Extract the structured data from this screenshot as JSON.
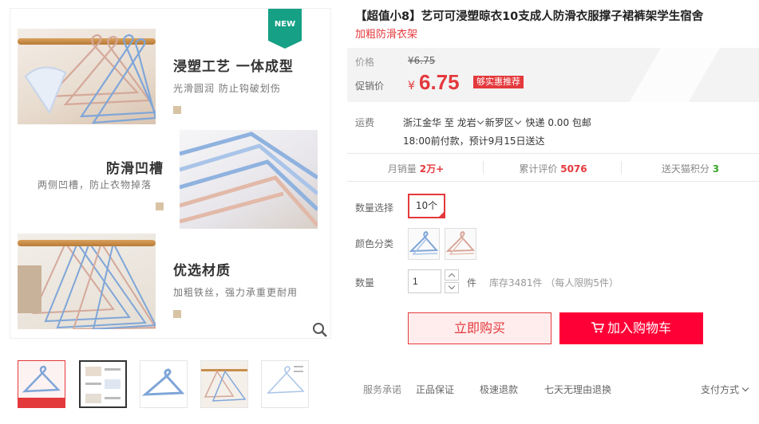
{
  "gallery": {
    "new_tag": "NEW",
    "features": [
      {
        "title": "浸塑工艺 一体成型",
        "subtitle": "光滑圆润 防止钩破划伤"
      },
      {
        "title": "防滑凹槽",
        "subtitle": "两侧凹槽，防止衣物掉落"
      },
      {
        "title": "优选材质",
        "subtitle": "加粗铁丝，强力承重更耐用"
      }
    ],
    "thumbnail_count": 5,
    "active_thumbnail": 2
  },
  "product": {
    "title": "【超值小8】艺可可浸塑晾衣10支成人防滑衣服撑子裙裤架学生宿舍",
    "subtitle": "加粗防滑衣架"
  },
  "price": {
    "label": "价格",
    "original": "¥6.75",
    "promo_label": "促销价",
    "currency": "¥",
    "promo": "6.75",
    "badge": "够实惠推荐"
  },
  "shipping": {
    "label": "运费",
    "from": "浙江金华",
    "to_word": "至",
    "dest_city": "龙岩",
    "dest_district": "新罗区",
    "express": "快递 0.00 包邮",
    "delivery_note": "18:00前付款，预计9月15日送达"
  },
  "stats": [
    {
      "label": "月销量",
      "value": "2万+",
      "color": "#e4393c"
    },
    {
      "label": "累计评价",
      "value": "5076",
      "color": "#e4393c"
    },
    {
      "label": "送天猫积分",
      "value": "3",
      "color": "#39a52a"
    }
  ],
  "options": {
    "quantity_choice_label": "数量选择",
    "quantity_choice_value": "10个",
    "color_label": "颜色分类",
    "colors": [
      "blue",
      "pink"
    ]
  },
  "quantity": {
    "label": "数量",
    "value": "1",
    "unit": "件",
    "stock": "库存3481件 （每人限购5件）"
  },
  "buttons": {
    "buy": "立即购买",
    "cart": "加入购物车"
  },
  "services": {
    "label": "服务承诺",
    "items": [
      "正品保证",
      "极速退款",
      "七天无理由退换"
    ],
    "payment": "支付方式"
  },
  "colors": {
    "accent": "#e4393c",
    "cart_button": "#ff0036",
    "new_tag": "#16a085"
  }
}
